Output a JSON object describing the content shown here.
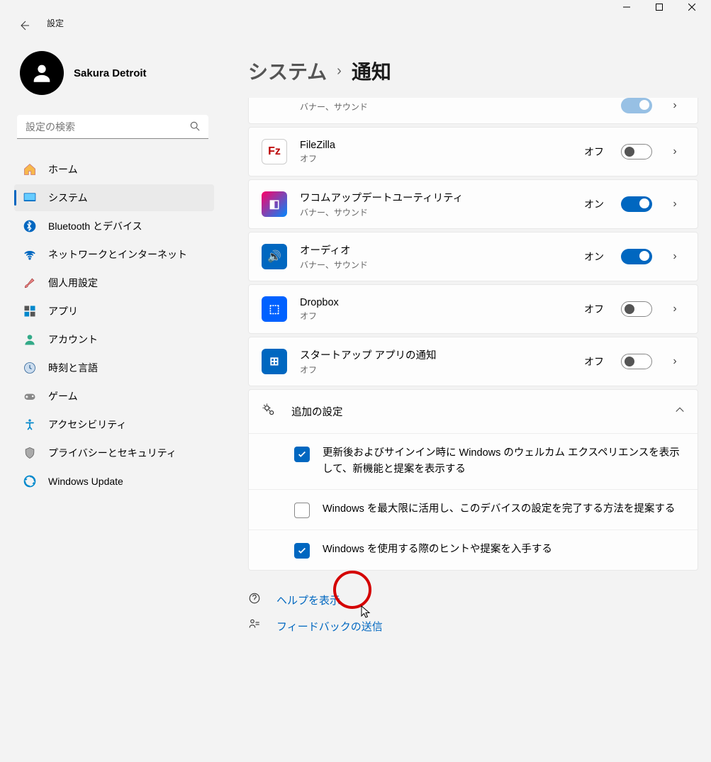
{
  "app": {
    "title": "設定"
  },
  "profile": {
    "name": "Sakura Detroit"
  },
  "search": {
    "placeholder": "設定の検索"
  },
  "nav": [
    {
      "label": "ホーム",
      "icon": "home"
    },
    {
      "label": "システム",
      "icon": "system",
      "active": true
    },
    {
      "label": "Bluetooth とデバイス",
      "icon": "bt"
    },
    {
      "label": "ネットワークとインターネット",
      "icon": "net"
    },
    {
      "label": "個人用設定",
      "icon": "brush"
    },
    {
      "label": "アプリ",
      "icon": "apps"
    },
    {
      "label": "アカウント",
      "icon": "account"
    },
    {
      "label": "時刻と言語",
      "icon": "time"
    },
    {
      "label": "ゲーム",
      "icon": "game"
    },
    {
      "label": "アクセシビリティ",
      "icon": "access"
    },
    {
      "label": "プライバシーとセキュリティ",
      "icon": "privacy"
    },
    {
      "label": "Windows Update",
      "icon": "update"
    }
  ],
  "breadcrumb": {
    "parent": "システム",
    "sep": "›",
    "current": "通知"
  },
  "partial": {
    "sub": "バナー、サウンド"
  },
  "apps": [
    {
      "title": "FileZilla",
      "sub": "オフ",
      "state": "オフ",
      "on": false,
      "iconBg": "#fff",
      "iconFg": "#b00",
      "glyph": "Fz",
      "border": true
    },
    {
      "title": "ワコムアップデートユーティリティ",
      "sub": "バナー、サウンド",
      "state": "オン",
      "on": true,
      "iconBg": "linear-gradient(135deg,#f06,#08f)",
      "iconFg": "#fff",
      "glyph": "◧"
    },
    {
      "title": "オーディオ",
      "sub": "バナー、サウンド",
      "state": "オン",
      "on": true,
      "iconBg": "#0067c0",
      "iconFg": "#fff",
      "glyph": "🔊"
    },
    {
      "title": "Dropbox",
      "sub": "オフ",
      "state": "オフ",
      "on": false,
      "iconBg": "#0061ff",
      "iconFg": "#fff",
      "glyph": "⬚"
    },
    {
      "title": "スタートアップ アプリの通知",
      "sub": "オフ",
      "state": "オフ",
      "on": false,
      "iconBg": "#0067c0",
      "iconFg": "#fff",
      "glyph": "⊞"
    }
  ],
  "expander": {
    "title": "追加の設定"
  },
  "checks": [
    {
      "checked": true,
      "label": "更新後およびサインイン時に Windows のウェルカム エクスペリエンスを表示して、新機能と提案を表示する"
    },
    {
      "checked": false,
      "label": "Windows を最大限に活用し、このデバイスの設定を完了する方法を提案する"
    },
    {
      "checked": true,
      "label": "Windows を使用する際のヒントや提案を入手する"
    }
  ],
  "footer": {
    "help": "ヘルプを表示",
    "feedback": "フィードバックの送信"
  }
}
